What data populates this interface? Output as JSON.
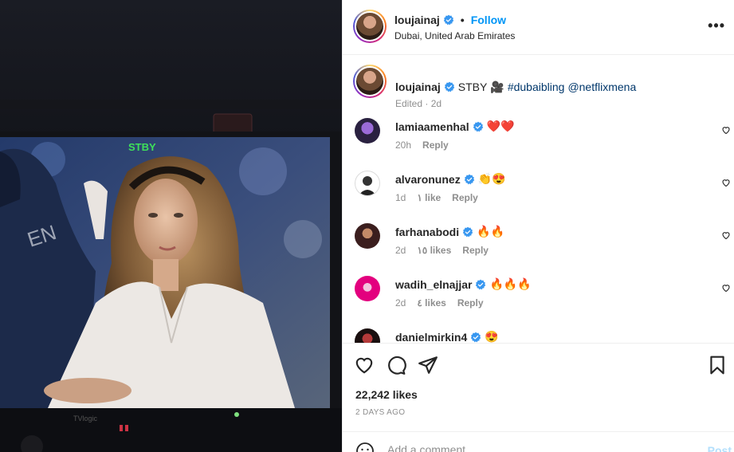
{
  "post": {
    "username": "loujainaj",
    "follow_label": "Follow",
    "separator": "•",
    "location": "Dubai, United Arab Emirates",
    "more_label": "•••",
    "photo_overlay_text": "STBY",
    "monitor_brand": "TVlogic"
  },
  "caption": {
    "username": "loujainaj",
    "text": "STBY",
    "emoji": "🎥",
    "hashtag": "#dubaibling",
    "mention": "@netflixmena",
    "meta": "Edited · 2d"
  },
  "comments": [
    {
      "username": "lamiaamenhal",
      "text": "❤️❤️",
      "time": "20h",
      "likes": "",
      "reply": "Reply"
    },
    {
      "username": "alvaronunez",
      "text": "👏😍",
      "time": "1d",
      "likes": "١ like",
      "reply": "Reply"
    },
    {
      "username": "farhanabodi",
      "text": "🔥🔥",
      "time": "2d",
      "likes": "١٥ likes",
      "reply": "Reply"
    },
    {
      "username": "wadih_elnajjar",
      "text": "🔥🔥🔥",
      "time": "2d",
      "likes": "٤ likes",
      "reply": "Reply"
    },
    {
      "username": "danielmirkin4",
      "text": "😍",
      "time": "",
      "likes": "",
      "reply": ""
    }
  ],
  "actions": {
    "likes_count": "22,242 likes",
    "date": "2 DAYS AGO"
  },
  "add_comment": {
    "placeholder": "Add a comment…",
    "post_label": "Post"
  },
  "colors": {
    "link": "#0095f6",
    "verified": "#3897f0",
    "muted": "#8e8e8e"
  }
}
